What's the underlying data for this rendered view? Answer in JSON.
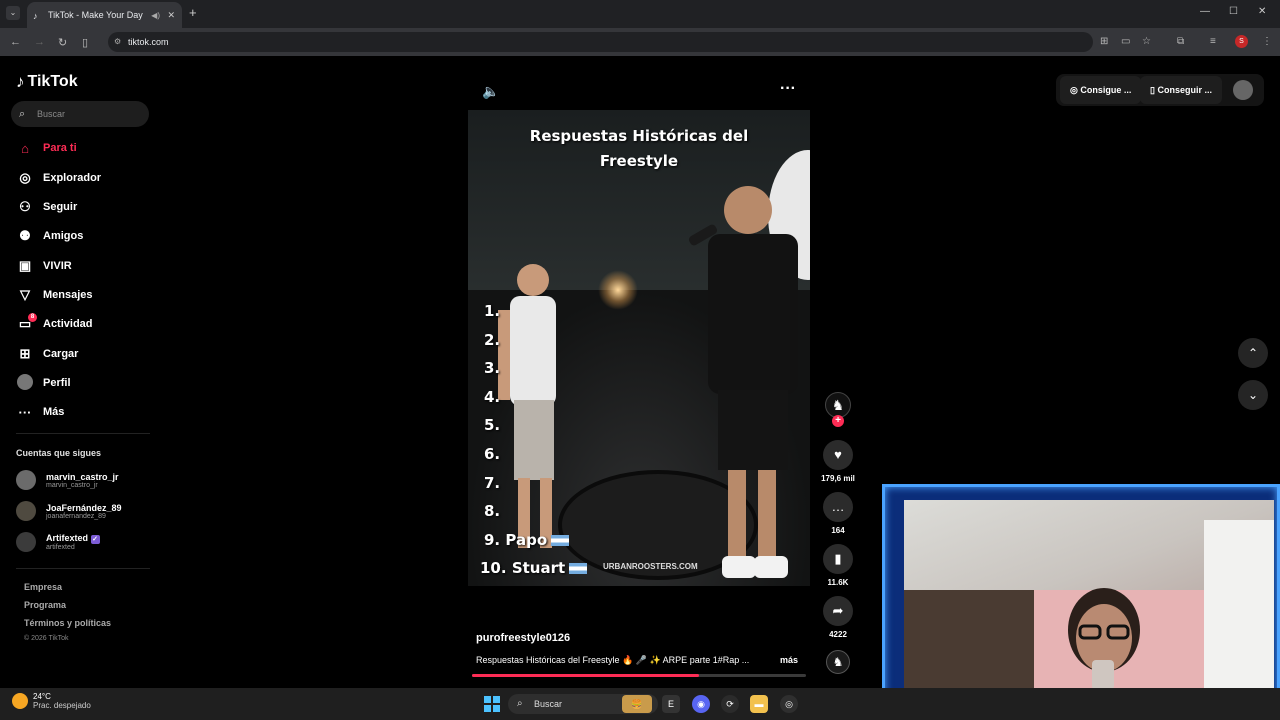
{
  "browser": {
    "tab_title": "TikTok - Make Your Day",
    "url": "tiktok.com",
    "profile_initial": "S"
  },
  "sidebar": {
    "logo": "TikTok",
    "search_placeholder": "Buscar",
    "nav": [
      {
        "label": "Para ti",
        "icon": "home-icon",
        "active": true
      },
      {
        "label": "Explorador",
        "icon": "compass-icon"
      },
      {
        "label": "Seguir",
        "icon": "user-follow-icon"
      },
      {
        "label": "Amigos",
        "icon": "friends-icon"
      },
      {
        "label": "VIVIR",
        "icon": "live-icon"
      },
      {
        "label": "Mensajes",
        "icon": "message-icon"
      },
      {
        "label": "Actividad",
        "icon": "activity-icon",
        "badge": "8"
      },
      {
        "label": "Cargar",
        "icon": "upload-icon"
      },
      {
        "label": "Perfil",
        "icon": "profile-avatar-icon"
      },
      {
        "label": "Más",
        "icon": "more-icon"
      }
    ],
    "following_title": "Cuentas que sigues",
    "following": [
      {
        "name": "marvin_castro_jr",
        "handle": "marvin_castro_jr"
      },
      {
        "name": "JoaFernández_89",
        "handle": "joanafernandez_89"
      },
      {
        "name": "Artifexted",
        "handle": "artifexted",
        "verified": true
      }
    ],
    "footer": [
      "Empresa",
      "Programa",
      "Términos y políticas"
    ],
    "copyright": "© 2026 TikTok"
  },
  "topbar": {
    "btn1": "Consigue ...",
    "btn2": "Conseguir ..."
  },
  "video": {
    "title_line1": "Respuestas Históricas del",
    "title_line2": "Freestyle",
    "ranks": [
      {
        "num": "1.",
        "name": ""
      },
      {
        "num": "2.",
        "name": ""
      },
      {
        "num": "3.",
        "name": ""
      },
      {
        "num": "4.",
        "name": ""
      },
      {
        "num": "5.",
        "name": ""
      },
      {
        "num": "6.",
        "name": ""
      },
      {
        "num": "7.",
        "name": ""
      },
      {
        "num": "8.",
        "name": ""
      },
      {
        "num": "9.",
        "name": "Papo"
      },
      {
        "num": "10.",
        "name": "Stuart"
      }
    ],
    "watermark": "URBANROOSTERS.COM",
    "author": "purofreestyle0126",
    "description": "Respuestas Históricas del Freestyle 🔥 🎤 ✨ ARPE parte 1#Rap ...",
    "more": "más",
    "progress": 0.68
  },
  "actions": {
    "likes": "179,6 mil",
    "comments": "164",
    "saves": "11.6K",
    "shares": "4222"
  },
  "taskbar": {
    "temp": "24°C",
    "weather": "Prac. despejado",
    "search": "Buscar"
  },
  "colors": {
    "accent": "#fe2c55",
    "webcam_border": "#4aa3ff"
  }
}
